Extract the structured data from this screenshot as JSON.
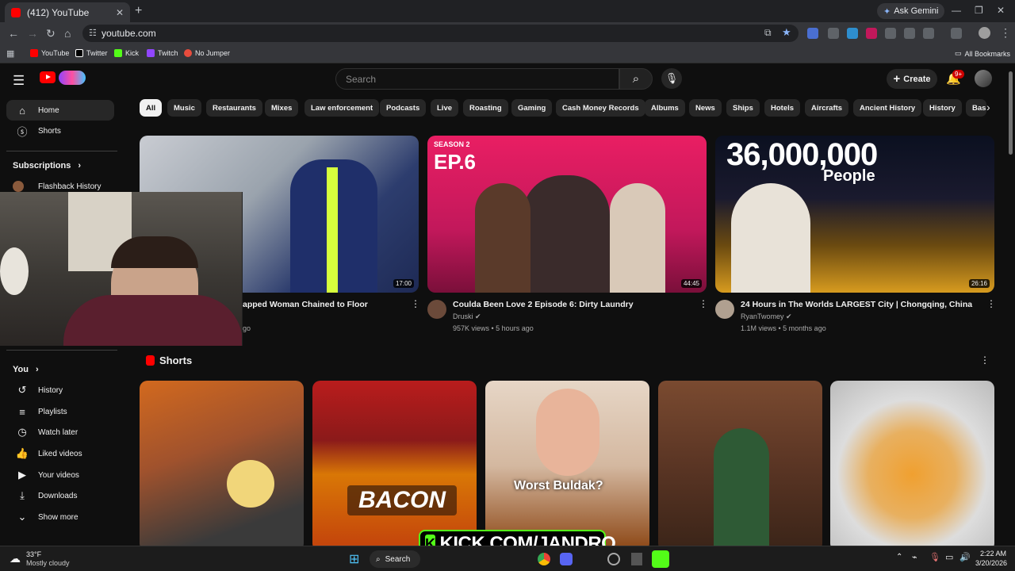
{
  "browser": {
    "tab_title": "(412) YouTube",
    "tab_close": "✕",
    "new_tab": "+",
    "ask_gemini": "Ask Gemini",
    "url": "youtube.com",
    "bookmarks": [
      {
        "label": "YouTube",
        "color": "#ff0000"
      },
      {
        "label": "Twitter",
        "color": "#ffffff"
      },
      {
        "label": "Kick",
        "color": "#53fc18"
      },
      {
        "label": "Twitch",
        "color": "#9146ff"
      },
      {
        "label": "No Jumper",
        "color": "#e84c3d"
      }
    ],
    "all_bookmarks": "All Bookmarks"
  },
  "youtube": {
    "search_placeholder": "Search",
    "create_label": "Create",
    "notifications_badge": "9+",
    "sidebar": {
      "items": [
        {
          "label": "Home",
          "icon": "home-icon"
        },
        {
          "label": "Shorts",
          "icon": "shorts-icon"
        }
      ],
      "subscriptions_label": "Subscriptions",
      "subscriptions": [
        {
          "label": "Flashback History"
        }
      ],
      "you_label": "You",
      "you_items": [
        {
          "label": "History",
          "icon": "history-icon"
        },
        {
          "label": "Playlists",
          "icon": "playlists-icon"
        },
        {
          "label": "Watch later",
          "icon": "clock-icon"
        },
        {
          "label": "Liked videos",
          "icon": "thumbs-up-icon"
        },
        {
          "label": "Your videos",
          "icon": "video-icon"
        },
        {
          "label": "Downloads",
          "icon": "download-icon"
        },
        {
          "label": "Show more",
          "icon": "chevron-down-icon"
        }
      ]
    },
    "chips": [
      "All",
      "Music",
      "Restaurants",
      "Mixes",
      "Law enforcement",
      "Podcasts",
      "Live",
      "Roasting",
      "Gaming",
      "Cash Money Records",
      "Albums",
      "News",
      "Ships",
      "Hotels",
      "Aircrafts",
      "Ancient History",
      "History",
      "Bas"
    ],
    "videos": [
      {
        "title": "apped Woman Chained to Floor",
        "channel": "",
        "meta": "go",
        "duration": "17:00"
      },
      {
        "title": "Coulda Been Love 2 Episode 6: Dirty Laundry",
        "channel": "Druski",
        "meta": "957K views • 5 hours ago",
        "duration": "44:45",
        "overlay_top": "SEASON 2",
        "overlay_ep": "EP.6"
      },
      {
        "title": "24 Hours in The Worlds LARGEST City | Chongqing, China",
        "channel": "RyanTwomey",
        "meta": "1.1M views • 5 months ago",
        "duration": "26:16",
        "overlay_big": "36,000,000",
        "overlay_small": "People"
      }
    ],
    "shorts_label": "Shorts",
    "shorts": [
      {
        "caption": ""
      },
      {
        "caption": "BACON"
      },
      {
        "caption": "Worst Buldak?"
      },
      {
        "caption": ""
      },
      {
        "caption": ""
      }
    ]
  },
  "stream_overlay": {
    "kick_text": "KICK.COM/JANDRO",
    "kick_letter": "K"
  },
  "taskbar": {
    "weather_temp": "33°F",
    "weather_desc": "Mostly cloudy",
    "search_label": "Search",
    "time": "2:22 AM",
    "date": "3/20/2026"
  }
}
